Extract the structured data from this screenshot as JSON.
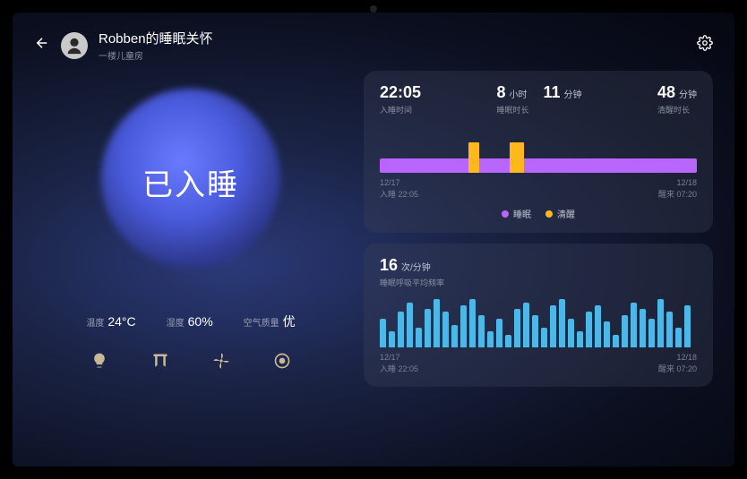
{
  "header": {
    "title": "Robben的睡眠关怀",
    "subtitle": "一楼儿童房"
  },
  "status": {
    "text": "已入睡"
  },
  "environment": {
    "temp_label": "温度",
    "temp_value": "24°C",
    "humidity_label": "湿度",
    "humidity_value": "60%",
    "air_label": "空气质量",
    "air_value": "优"
  },
  "sleep_card": {
    "fall_asleep_time": "22:05",
    "fall_asleep_label": "入睡时间",
    "duration_hours": "8",
    "duration_hours_unit": "小时",
    "duration_mins": "11",
    "duration_mins_unit": "分钟",
    "duration_label": "睡眠时长",
    "awake_mins": "48",
    "awake_mins_unit": "分钟",
    "awake_label": "清醒时长",
    "axis_start_date": "12/17",
    "axis_start_label": "入睡 22:05",
    "axis_end_date": "12/18",
    "axis_end_label": "醒来 07:20",
    "legend_sleep": "睡眠",
    "legend_awake": "清醒"
  },
  "breath_card": {
    "value": "16",
    "unit": "次/分钟",
    "label": "睡眠呼吸平均频率",
    "axis_start_date": "12/17",
    "axis_start_label": "入睡 22:05",
    "axis_end_date": "12/18",
    "axis_end_label": "醒来 07:20"
  },
  "colors": {
    "sleep_bar": "#b866ff",
    "awake_bar": "#ffb81c",
    "breath_bar": "#4db8e8"
  },
  "chart_data": [
    {
      "type": "bar",
      "title": "睡眠/清醒时段",
      "x_range_label": [
        "12/17 22:05",
        "12/18 07:20"
      ],
      "series": [
        {
          "name": "睡眠",
          "color": "#b866ff",
          "segments": [
            [
              0,
              28
            ],
            [
              31,
              41
            ],
            [
              44,
              100
            ]
          ]
        },
        {
          "name": "清醒",
          "color": "#ffb81c",
          "segments": [
            [
              28,
              31
            ],
            [
              41,
              44
            ]
          ]
        }
      ]
    },
    {
      "type": "bar",
      "title": "睡眠呼吸平均频率",
      "ylabel": "次/分钟",
      "x_range_label": [
        "12/17 22:05",
        "12/18 07:20"
      ],
      "values": [
        18,
        10,
        22,
        28,
        12,
        24,
        30,
        22,
        14,
        26,
        30,
        20,
        10,
        18,
        8,
        24,
        28,
        20,
        12,
        26,
        30,
        18,
        10,
        22,
        26,
        16,
        8,
        20,
        28,
        24,
        18,
        30,
        22,
        12,
        26
      ]
    }
  ]
}
